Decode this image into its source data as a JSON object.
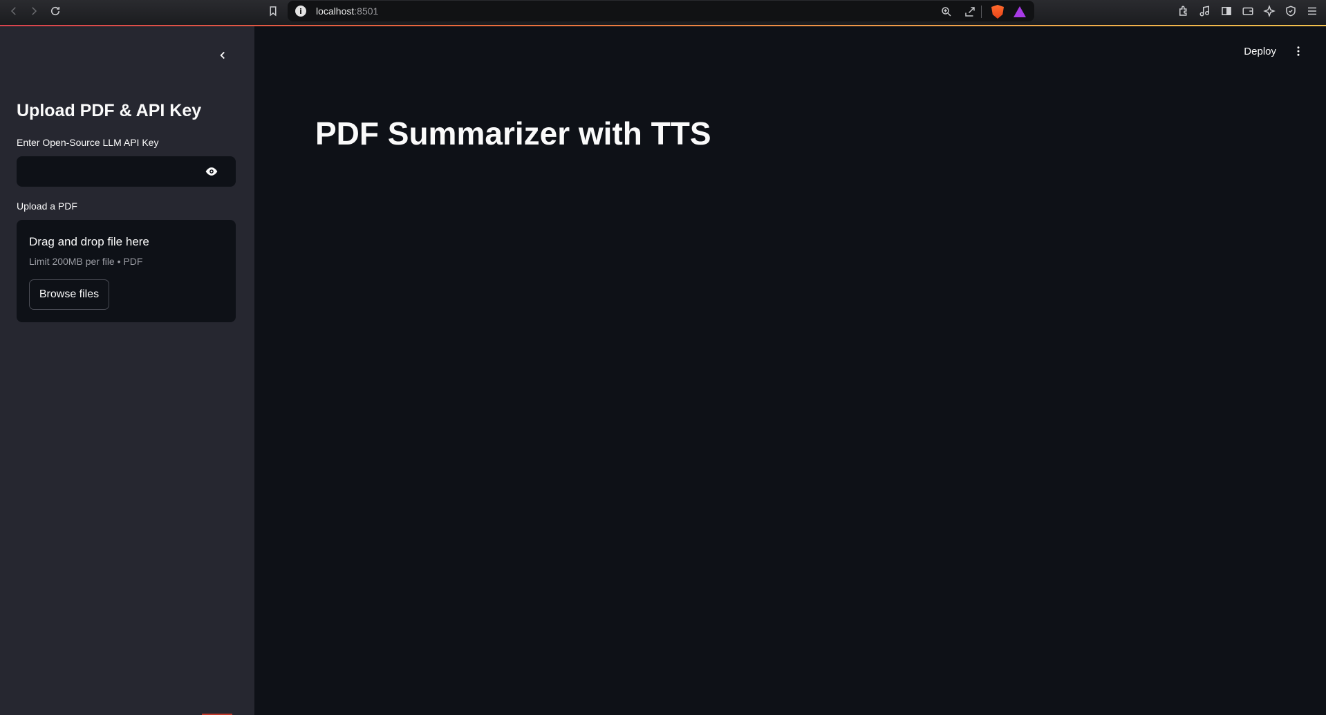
{
  "browser": {
    "url_host": "localhost",
    "url_port": ":8501",
    "icons": [
      "back-icon",
      "forward-icon",
      "reload-icon",
      "bookmark-icon",
      "site-info-icon",
      "zoom-icon",
      "share-icon",
      "brave-shields-icon",
      "brave-rewards-icon",
      "extensions-icon",
      "media-icon",
      "sidebar-icon",
      "wallet-icon",
      "leo-icon",
      "vpn-icon",
      "menu-icon"
    ],
    "accent_colors": [
      "#d9434e",
      "#f3c24d"
    ]
  },
  "sidebar": {
    "title": "Upload PDF & API Key",
    "api_key_label": "Enter Open-Source LLM API Key",
    "api_key_value": "",
    "upload_label": "Upload a PDF",
    "dropzone_title": "Drag and drop file here",
    "dropzone_limit": "Limit 200MB per file • PDF",
    "browse_label": "Browse files"
  },
  "header": {
    "deploy_label": "Deploy"
  },
  "main": {
    "title": "PDF Summarizer with TTS"
  },
  "colors": {
    "sidebar_bg": "#262730",
    "main_bg": "#0e1117",
    "text": "#fafafa"
  }
}
